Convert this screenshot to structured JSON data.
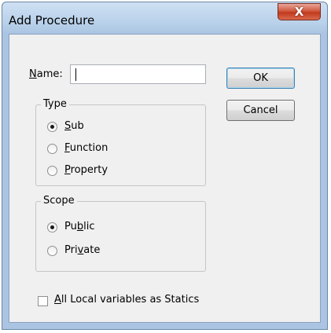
{
  "window": {
    "title": "Add Procedure",
    "close_glyph": "X"
  },
  "name_field": {
    "label_prefix": "",
    "label_accel": "N",
    "label_rest": "ame:",
    "value": ""
  },
  "buttons": {
    "ok": "OK",
    "cancel": "Cancel"
  },
  "type_group": {
    "title": "Type",
    "options": [
      {
        "pre": "",
        "accel": "S",
        "post": "ub",
        "checked": true
      },
      {
        "pre": "",
        "accel": "F",
        "post": "unction",
        "checked": false
      },
      {
        "pre": "",
        "accel": "P",
        "post": "roperty",
        "checked": false
      }
    ]
  },
  "scope_group": {
    "title": "Scope",
    "options": [
      {
        "pre": "Pu",
        "accel": "b",
        "post": "lic",
        "checked": true
      },
      {
        "pre": "Pri",
        "accel": "v",
        "post": "ate",
        "checked": false
      }
    ]
  },
  "statics_checkbox": {
    "pre": "",
    "accel": "A",
    "post": "ll Local variables as Statics",
    "checked": false
  }
}
